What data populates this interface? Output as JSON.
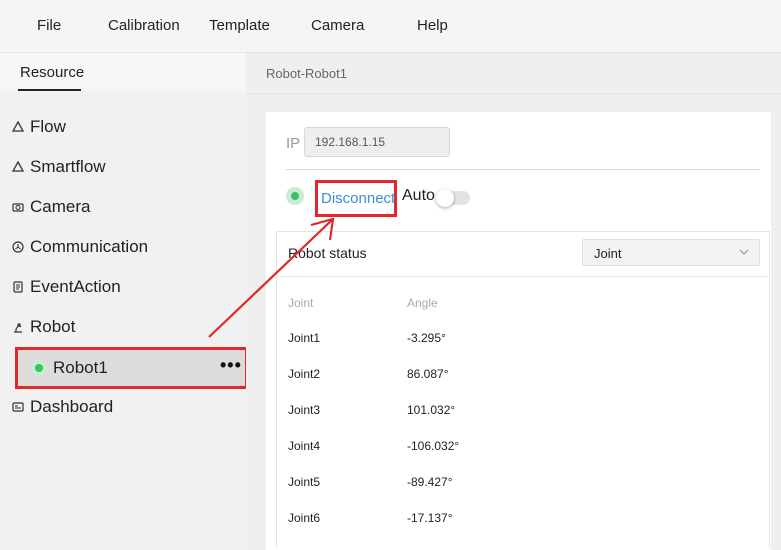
{
  "menu": {
    "items": [
      "File",
      "Calibration",
      "Template",
      "Camera",
      "Help"
    ]
  },
  "sidebar": {
    "tab_label": "Resource",
    "items": [
      {
        "label": "Flow",
        "icon": "flow-icon"
      },
      {
        "label": "Smartflow",
        "icon": "smartflow-icon"
      },
      {
        "label": "Camera",
        "icon": "camera-icon"
      },
      {
        "label": "Communication",
        "icon": "communication-icon"
      },
      {
        "label": "EventAction",
        "icon": "eventaction-icon"
      },
      {
        "label": "Robot",
        "icon": "robot-icon"
      }
    ],
    "robot_child": {
      "label": "Robot1",
      "status": "connected",
      "more": "•••"
    },
    "dashboard": {
      "label": "Dashboard",
      "icon": "dashboard-icon"
    }
  },
  "main": {
    "breadcrumb": "Robot-Robot1",
    "ip_label": "IP",
    "ip_value": "192.168.1.15",
    "disconnect_label": "Disconnect",
    "auto_label": "Auto",
    "auto_enabled": false,
    "status_title": "Robot status",
    "mode_select": "Joint",
    "table": {
      "headers": [
        "Joint",
        "Angle"
      ],
      "rows": [
        [
          "Joint1",
          "-3.295°"
        ],
        [
          "Joint2",
          "86.087°"
        ],
        [
          "Joint3",
          "101.032°"
        ],
        [
          "Joint4",
          "-106.032°"
        ],
        [
          "Joint5",
          "-89.427°"
        ],
        [
          "Joint6",
          "-17.137°"
        ]
      ]
    }
  },
  "colors": {
    "highlight": "#e0282a",
    "link": "#3b8ed6",
    "status_green": "#3cbf6a"
  }
}
